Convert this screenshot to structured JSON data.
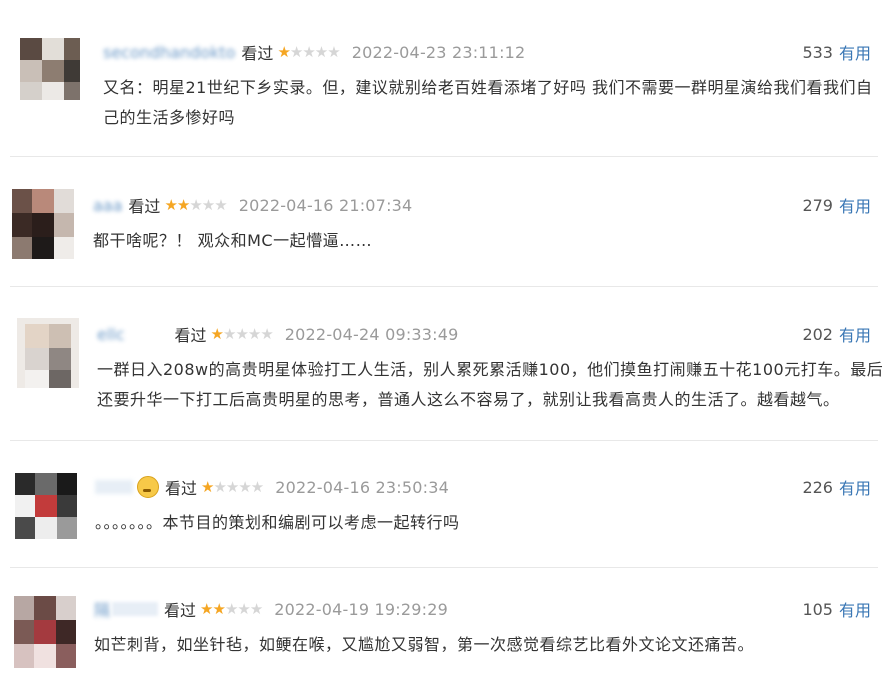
{
  "comments": [
    {
      "username": "secondhandokto",
      "watched": "看过",
      "rating": 1,
      "time": "2022-04-23 23:11:12",
      "votes": "533",
      "useful": "有用",
      "text_lines": [
        "又名：明星21世纪下乡实录。但，建议就别给老百姓看添堵了好吗 我们不需要一群明星演给我们看我们自",
        "己的生活多惨好吗"
      ]
    },
    {
      "username": "aaa",
      "watched": "看过",
      "rating": 2,
      "time": "2022-04-16 21:07:34",
      "votes": "279",
      "useful": "有用",
      "text_lines": [
        "都干啥呢？！ 观众和MC一起懵逼……"
      ]
    },
    {
      "username": "ellc",
      "watched": "看过",
      "rating": 1,
      "time": "2022-04-24 09:33:49",
      "votes": "202",
      "useful": "有用",
      "text_lines": [
        "一群日入208w的高贵明星体验打工人生活，别人累死累活赚100，他们摸鱼打闹赚五十花100元打车。最后",
        "还要升华一下打工后高贵明星的思考，普通人这么不容易了，就别让我看高贵人的生活了。越看越气。"
      ]
    },
    {
      "username": "",
      "watched": "看过",
      "rating": 1,
      "time": "2022-04-16 23:50:34",
      "votes": "226",
      "useful": "有用",
      "text_lines": [
        "。。。。。。。本节目的策划和编剧可以考虑一起转行吗"
      ]
    },
    {
      "username": "隔",
      "watched": "看过",
      "rating": 2,
      "time": "2022-04-19 19:29:29",
      "votes": "105",
      "useful": "有用",
      "text_lines": [
        "如芒刺背，如坐针毡，如鲠在喉，又尴尬又弱智，第一次感觉看综艺比看外文论文还痛苦。"
      ]
    }
  ],
  "colors": {
    "link": "#3a77b5",
    "star": "#f5a623",
    "star_off": "#d6d6d6",
    "time": "#9a9a9a"
  }
}
